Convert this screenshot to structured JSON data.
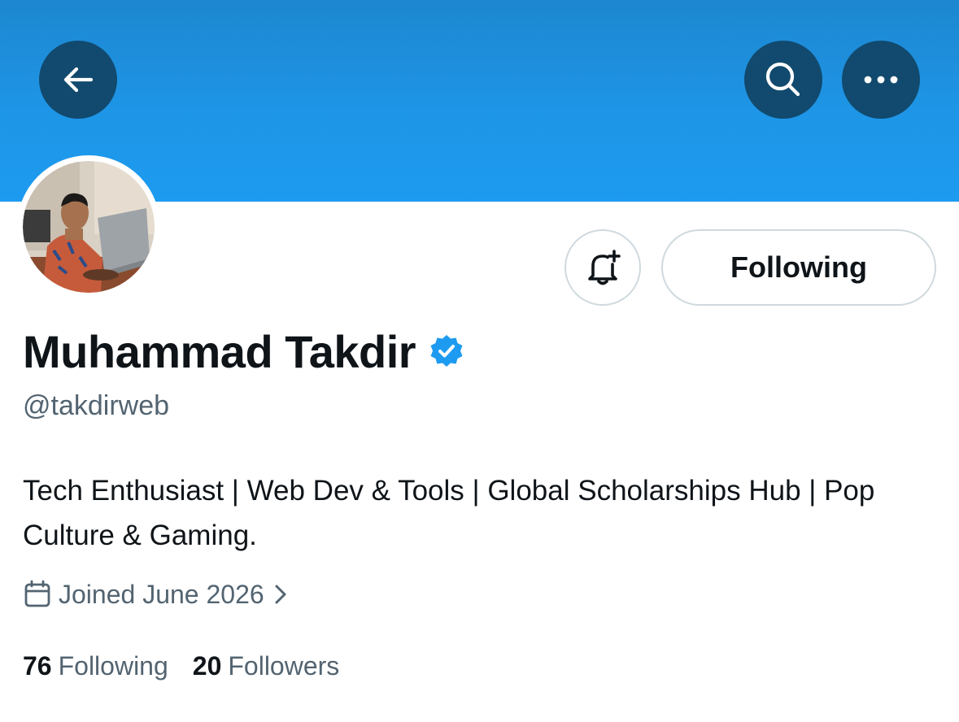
{
  "header": {
    "back_icon": "arrow-left-icon",
    "search_icon": "search-icon",
    "more_icon": "more-horizontal-icon",
    "banner_color": "#1d9bf0",
    "button_color": "#114a6e"
  },
  "profile": {
    "name": "Muhammad Takdir",
    "verified_icon": "verified-badge-icon",
    "verified_color": "#1d9bf0",
    "handle": "@takdirweb",
    "bio": "Tech Enthusiast | Web Dev & Tools | Global Scholarships Hub | Pop Culture & Gaming.",
    "joined": "Joined June 2026"
  },
  "actions": {
    "notify_icon": "bell-plus-icon",
    "following_label": "Following"
  },
  "stats": {
    "following_count": "76",
    "following_label": "Following",
    "followers_count": "20",
    "followers_label": "Followers"
  }
}
